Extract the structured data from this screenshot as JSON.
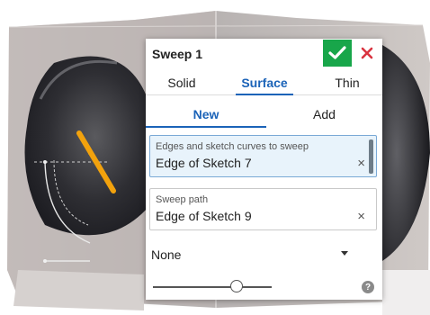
{
  "dialog": {
    "title": "Sweep 1",
    "accept_icon": "checkmark-icon",
    "cancel_icon": "close-icon",
    "body_types": [
      "Solid",
      "Surface",
      "Thin"
    ],
    "selected_body_type": "Surface",
    "operations": [
      "New",
      "Add"
    ],
    "selected_operation": "New",
    "profiles_field": {
      "label": "Edges and sketch curves to sweep",
      "value": "Edge of Sketch 7",
      "clear": "×"
    },
    "path_field": {
      "label": "Sweep path",
      "value": "Edge of Sketch 9",
      "clear": "×"
    },
    "profile_control": {
      "value": "None"
    },
    "help": "?"
  },
  "colors": {
    "accent_blue": "#1b63b8",
    "accept_green": "#18a64a",
    "cancel_red": "#d9333f",
    "profile_curve_orange": "#f2a20d"
  }
}
